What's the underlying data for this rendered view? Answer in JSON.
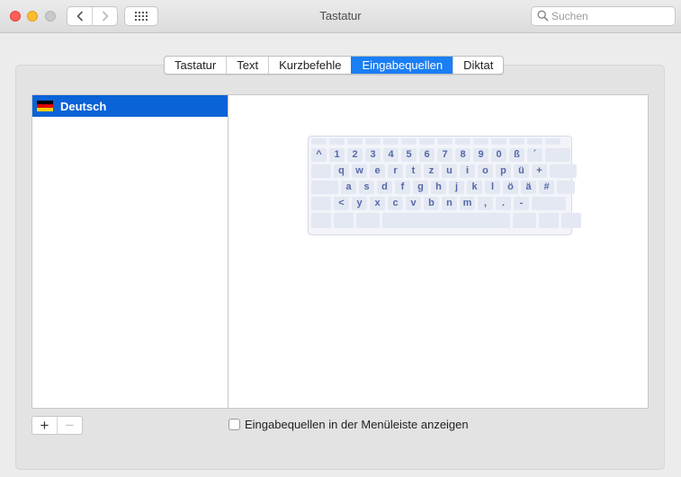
{
  "window": {
    "title": "Tastatur"
  },
  "search": {
    "placeholder": "Suchen"
  },
  "nav": {
    "back_icon": "chevron-left-icon",
    "forward_icon": "chevron-right-icon",
    "grid_icon": "show-all-grid-icon"
  },
  "tabs": [
    {
      "label": "Tastatur",
      "active": false
    },
    {
      "label": "Text",
      "active": false
    },
    {
      "label": "Kurzbefehle",
      "active": false
    },
    {
      "label": "Eingabequellen",
      "active": true
    },
    {
      "label": "Diktat",
      "active": false
    }
  ],
  "input_sources": [
    {
      "label": "Deutsch",
      "flag_colors": [
        "#000000",
        "#dd0000",
        "#ffce00"
      ],
      "selected": true
    }
  ],
  "keyboard": {
    "rows": [
      [
        "^",
        "1",
        "2",
        "3",
        "4",
        "5",
        "6",
        "7",
        "8",
        "9",
        "0",
        "ß",
        "´"
      ],
      [
        "q",
        "w",
        "e",
        "r",
        "t",
        "z",
        "u",
        "i",
        "o",
        "p",
        "ü",
        "+"
      ],
      [
        "a",
        "s",
        "d",
        "f",
        "g",
        "h",
        "j",
        "k",
        "l",
        "ö",
        "ä",
        "#"
      ],
      [
        "<",
        "y",
        "x",
        "c",
        "v",
        "b",
        "n",
        "m",
        ",",
        ".",
        "-"
      ]
    ]
  },
  "bottom": {
    "add_label": "+",
    "remove_label": "−",
    "show_in_menubar_label": "Eingabequellen in der Menüleiste anzeigen",
    "show_in_menubar_checked": false
  },
  "colors": {
    "accent": "#1a7ef5",
    "selection": "#0a63d7"
  }
}
